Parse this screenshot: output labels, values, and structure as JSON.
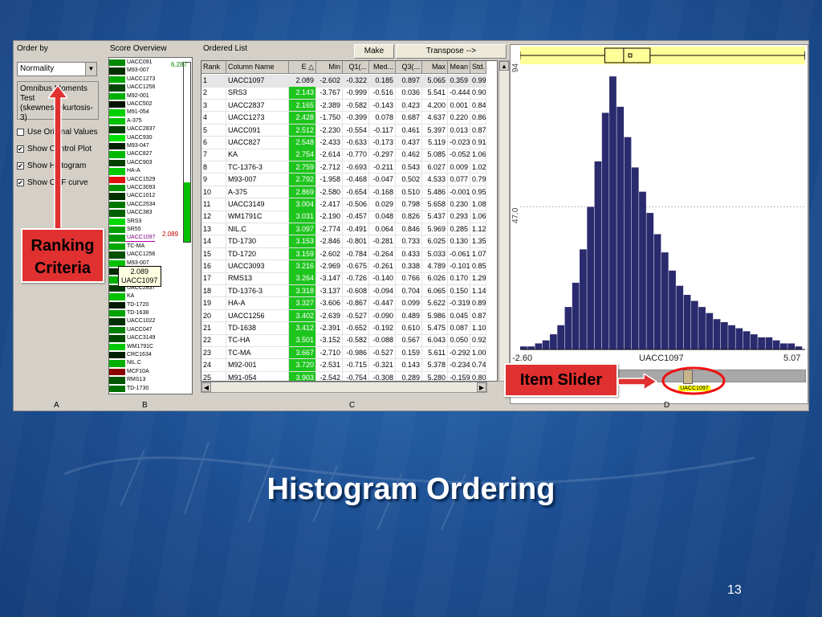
{
  "slide": {
    "title": "Histogram Ordering",
    "page_number": "13"
  },
  "panel_a": {
    "header": "Order by",
    "combo_value": "Normality",
    "test_text": "Omnibus Moments Test (skewness+kurtosis-3)",
    "checkboxes": [
      {
        "label": "Use Original Values",
        "checked": false
      },
      {
        "label": "Show Control Plot",
        "checked": true
      },
      {
        "label": "Show Histogram",
        "checked": true
      },
      {
        "label": "Show CDF curve",
        "checked": true
      }
    ],
    "footer": "A"
  },
  "panel_b": {
    "header": "Score Overview",
    "max_value": "6.287",
    "current_value": "2.089",
    "score_fraction": 0.33,
    "tooltip_value": "2.089",
    "tooltip_name": "UACC1097",
    "items": [
      {
        "label": "UACC091",
        "color": "#008a00"
      },
      {
        "label": "M93-007",
        "color": "#003000"
      },
      {
        "label": "UACC1273",
        "color": "#00a800"
      },
      {
        "label": "UACC1256",
        "color": "#004500"
      },
      {
        "label": "M92-001",
        "color": "#00b000"
      },
      {
        "label": "UACC502",
        "color": "#001500"
      },
      {
        "label": "M91-054",
        "color": "#00d000"
      },
      {
        "label": "A-375",
        "color": "#00c000"
      },
      {
        "label": "UACC2837",
        "color": "#003d00"
      },
      {
        "label": "UACC930",
        "color": "#00e000"
      },
      {
        "label": "M93-047",
        "color": "#002000"
      },
      {
        "label": "UACC827",
        "color": "#00b800"
      },
      {
        "label": "UACC903",
        "color": "#004000"
      },
      {
        "label": "HA-A",
        "color": "#00c800"
      },
      {
        "label": "UACC1529",
        "color": "#e01010"
      },
      {
        "label": "UACC3093",
        "color": "#009000"
      },
      {
        "label": "UACC1012",
        "color": "#003000"
      },
      {
        "label": "UACC2534",
        "color": "#007800"
      },
      {
        "label": "UACC383",
        "color": "#006000"
      },
      {
        "label": "SRS3",
        "color": "#00d800"
      },
      {
        "label": "SR55",
        "color": "#00a000"
      },
      {
        "label": "UACC1097",
        "color": "#009600"
      },
      {
        "label": "TC-MA",
        "color": "#00a800"
      },
      {
        "label": "UACC1256",
        "color": "#005000"
      },
      {
        "label": "M93-007",
        "color": "#00c000"
      },
      {
        "label": "UACC1273",
        "color": "#002a00"
      },
      {
        "label": "TC-HA",
        "color": "#00b000"
      },
      {
        "label": "UACC2837",
        "color": "#003a00"
      },
      {
        "label": "KA",
        "color": "#00c000"
      },
      {
        "label": "TD-1720",
        "color": "#001c00"
      },
      {
        "label": "TD-1638",
        "color": "#00a200"
      },
      {
        "label": "UACC1022",
        "color": "#003000"
      },
      {
        "label": "UACC047",
        "color": "#008000"
      },
      {
        "label": "UACC3149",
        "color": "#004a00"
      },
      {
        "label": "WM1791C",
        "color": "#00c800"
      },
      {
        "label": "CRC1634",
        "color": "#002000"
      },
      {
        "label": "NIL.C",
        "color": "#00b000"
      },
      {
        "label": "MCF10A",
        "color": "#8a0000"
      },
      {
        "label": "RMS13",
        "color": "#005500"
      },
      {
        "label": "TD-1730",
        "color": "#007000"
      }
    ],
    "footer": "B"
  },
  "panel_c": {
    "header": "Ordered List",
    "make_views": "Make Views",
    "transpose": "Transpose -->",
    "columns": [
      "Rank",
      "Column Name",
      "E △",
      "Min",
      "Q1(...",
      "Med...",
      "Q3(...",
      "Max",
      "Mean",
      "Std."
    ],
    "rows": [
      [
        "1",
        "UACC1097",
        "2.089",
        "-2.602",
        "-0.322",
        "0.185",
        "0.897",
        "5.065",
        "0.359",
        "0.99"
      ],
      [
        "2",
        "SRS3",
        "2.143",
        "-3.767",
        "-0.999",
        "-0.516",
        "0.036",
        "5.541",
        "-0.444",
        "0.90"
      ],
      [
        "3",
        "UACC2837",
        "2.165",
        "-2.389",
        "-0.582",
        "-0.143",
        "0.423",
        "4.200",
        "0.001",
        "0.84"
      ],
      [
        "4",
        "UACC1273",
        "2.428",
        "-1.750",
        "-0.399",
        "0.078",
        "0.687",
        "4.637",
        "0.220",
        "0.86"
      ],
      [
        "5",
        "UACC091",
        "2.512",
        "-2.230",
        "-0.554",
        "-0.117",
        "0.461",
        "5.397",
        "0.013",
        "0.87"
      ],
      [
        "6",
        "UACC827",
        "2.548",
        "-2.433",
        "-0.633",
        "-0.173",
        "0.437",
        "5.119",
        "-0.023",
        "0.91"
      ],
      [
        "7",
        "KA",
        "2.754",
        "-2.614",
        "-0.770",
        "-0.297",
        "0.462",
        "5.085",
        "-0.052",
        "1.06"
      ],
      [
        "8",
        "TC-1376-3",
        "2.759",
        "-2.712",
        "-0.693",
        "-0.211",
        "0.543",
        "6.027",
        "0.009",
        "1.02"
      ],
      [
        "9",
        "M93-007",
        "2.792",
        "-1.958",
        "-0.468",
        "-0.047",
        "0.502",
        "4.533",
        "0.077",
        "0.79"
      ],
      [
        "10",
        "A-375",
        "2.869",
        "-2.580",
        "-0.654",
        "-0.168",
        "0.510",
        "5.486",
        "-0.001",
        "0.95"
      ],
      [
        "11",
        "UACC3149",
        "3.004",
        "-2.417",
        "-0.506",
        "0.029",
        "0.798",
        "5.658",
        "0.230",
        "1.08"
      ],
      [
        "12",
        "WM1791C",
        "3.031",
        "-2.190",
        "-0.457",
        "0.048",
        "0.826",
        "5.437",
        "0.293",
        "1.06"
      ],
      [
        "13",
        "NIL.C",
        "3.097",
        "-2.774",
        "-0.491",
        "0.064",
        "0.846",
        "5.969",
        "0.285",
        "1.12"
      ],
      [
        "14",
        "TD-1730",
        "3.153",
        "-2.846",
        "-0.801",
        "-0.281",
        "0.733",
        "6.025",
        "0.130",
        "1.35"
      ],
      [
        "15",
        "TD-1720",
        "3.159",
        "-2.602",
        "-0.784",
        "-0.264",
        "0.433",
        "5.033",
        "-0.061",
        "1.07"
      ],
      [
        "16",
        "UACC3093",
        "3.216",
        "-2.969",
        "-0.675",
        "-0.261",
        "0.338",
        "4.789",
        "-0.101",
        "0.85"
      ],
      [
        "17",
        "RMS13",
        "3.264",
        "-3.147",
        "-0.726",
        "-0.140",
        "0.766",
        "6.026",
        "0.170",
        "1.29"
      ],
      [
        "18",
        "TD-1376-3",
        "3.318",
        "-3.137",
        "-0.608",
        "-0.094",
        "0.704",
        "6.065",
        "0.150",
        "1.14"
      ],
      [
        "19",
        "HA-A",
        "3.327",
        "-3.606",
        "-0.867",
        "-0.447",
        "0.099",
        "5.622",
        "-0.319",
        "0.89"
      ],
      [
        "20",
        "UACC1256",
        "3.402",
        "-2.639",
        "-0.527",
        "-0.090",
        "0.489",
        "5.986",
        "0.045",
        "0.87"
      ],
      [
        "21",
        "TD-1638",
        "3.412",
        "-2.391",
        "-0.652",
        "-0.192",
        "0.610",
        "5.475",
        "0.087",
        "1.10"
      ],
      [
        "22",
        "TC-HA",
        "3.501",
        "-3.152",
        "-0.582",
        "-0.088",
        "0.567",
        "6.043",
        "0.050",
        "0.92"
      ],
      [
        "23",
        "TC-MA",
        "3.667",
        "-2.710",
        "-0.986",
        "-0.527",
        "0.159",
        "5.611",
        "-0.292",
        "1.00"
      ],
      [
        "24",
        "M92-001",
        "3.720",
        "-2.531",
        "-0.715",
        "-0.321",
        "0.143",
        "5.378",
        "-0.234",
        "0.74"
      ],
      [
        "25",
        "M91-054",
        "3.903",
        "-2.542",
        "-0.754",
        "-0.308",
        "0.289",
        "5.280",
        "-0.159",
        "0.80"
      ]
    ],
    "footer": "C"
  },
  "panel_d": {
    "y_tick_top": "94",
    "y_tick_mid": "47.0",
    "x_min": "-2.60",
    "x_max": "5.07",
    "x_label": "UACC1097",
    "slider_tag": "UACC1097",
    "slider_fraction": 0.59,
    "footer": "D"
  },
  "chart_data": {
    "type": "bar",
    "xlim": [
      -2.6,
      5.07
    ],
    "ylim": [
      0,
      94
    ],
    "xlabel": "UACC1097",
    "ylabel": "",
    "bin_centers": [
      -2.5,
      -2.3,
      -2.1,
      -1.9,
      -1.7,
      -1.5,
      -1.3,
      -1.1,
      -0.9,
      -0.7,
      -0.5,
      -0.3,
      -0.1,
      0.1,
      0.3,
      0.5,
      0.7,
      0.9,
      1.1,
      1.3,
      1.5,
      1.7,
      1.9,
      2.1,
      2.3,
      2.5,
      2.7,
      2.9,
      3.1,
      3.3,
      3.5,
      3.7,
      3.9,
      4.1,
      4.3,
      4.5,
      4.7,
      4.9
    ],
    "values": [
      1,
      1,
      2,
      3,
      5,
      8,
      14,
      22,
      33,
      47,
      62,
      78,
      90,
      80,
      70,
      60,
      52,
      45,
      38,
      32,
      26,
      21,
      18,
      16,
      14,
      12,
      10,
      9,
      8,
      7,
      6,
      5,
      4,
      4,
      3,
      2,
      2,
      1
    ],
    "boxplot": {
      "min": -2.602,
      "q1": -0.322,
      "median": 0.185,
      "q3": 0.897,
      "max": 5.065,
      "mean": 0.359
    }
  },
  "annotations": {
    "ranking_criteria": "Ranking Criteria",
    "item_slider": "Item Slider"
  }
}
